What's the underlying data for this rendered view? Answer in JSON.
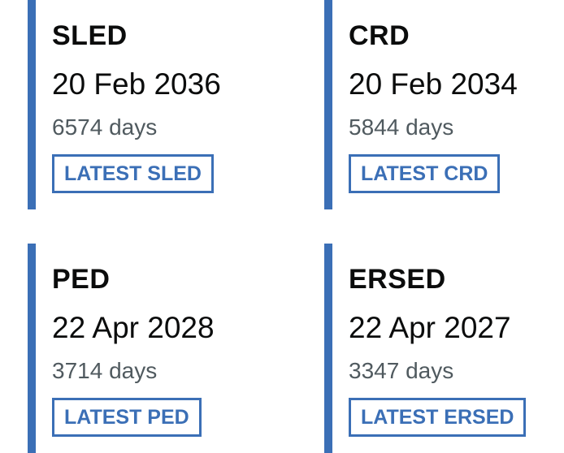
{
  "cards": [
    {
      "label": "SLED",
      "date": "20 Feb 2036",
      "days": "6574 days",
      "tag": "LATEST SLED"
    },
    {
      "label": "CRD",
      "date": "20 Feb 2034",
      "days": "5844 days",
      "tag": "LATEST CRD"
    },
    {
      "label": "PED",
      "date": "22 Apr 2028",
      "days": "3714 days",
      "tag": "LATEST PED"
    },
    {
      "label": "ERSED",
      "date": "22 Apr 2027",
      "days": "3347 days",
      "tag": "LATEST ERSED"
    }
  ],
  "colors": {
    "accent": "#3b6fb6",
    "text": "#0b0c0c",
    "secondary_text": "#505a5f",
    "background": "#ffffff"
  }
}
